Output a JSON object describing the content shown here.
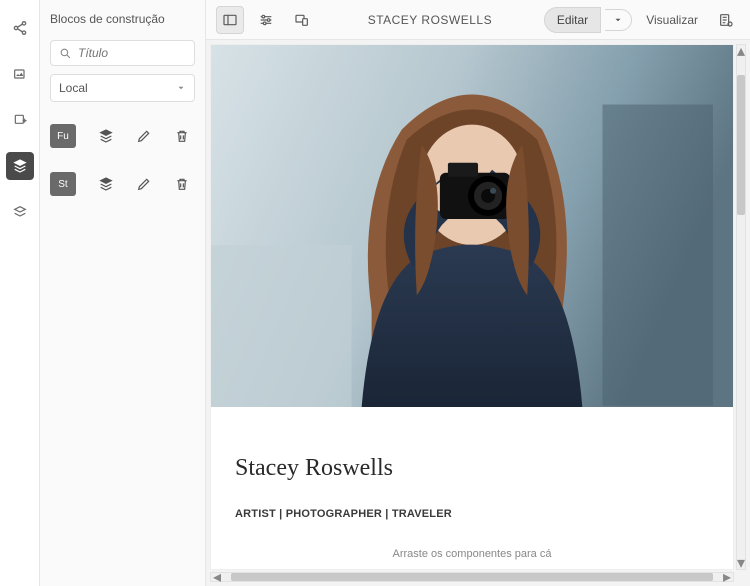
{
  "panel": {
    "title": "Blocos de construção",
    "search_placeholder": "Título",
    "select_label": "Local",
    "blocks": [
      {
        "tag": "Fu"
      },
      {
        "tag": "St"
      }
    ]
  },
  "topbar": {
    "title": "STACEY ROSWELLS",
    "edit_label": "Editar",
    "view_label": "Visualizar"
  },
  "page": {
    "heading": "Stacey Roswells",
    "subheading": "ARTIST | PHOTOGRAPHER | TRAVELER",
    "dropzone": "Arraste os componentes para cá"
  }
}
